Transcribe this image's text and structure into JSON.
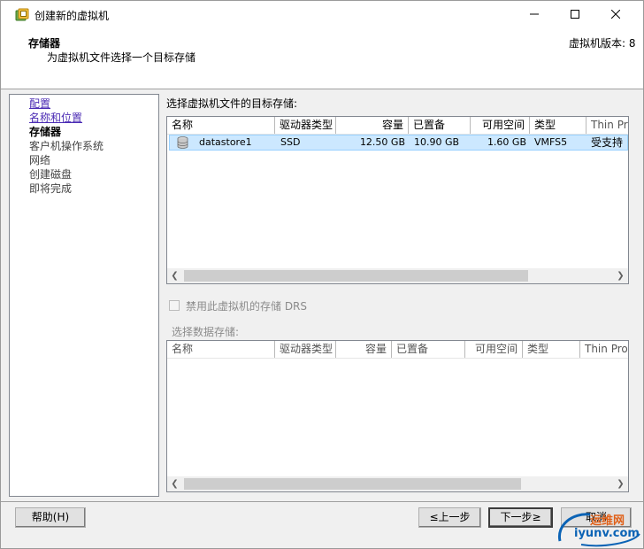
{
  "window": {
    "title": "创建新的虚拟机",
    "icon": "vm-wizard-icon"
  },
  "header": {
    "title": "存储器",
    "subtitle": "为虚拟机文件选择一个目标存储",
    "version_label": "虚拟机版本: 8"
  },
  "nav": {
    "items": [
      {
        "label": "配置",
        "state": "link"
      },
      {
        "label": "名称和位置",
        "state": "link"
      },
      {
        "label": "存储器",
        "state": "current"
      },
      {
        "label": "客户机操作系统",
        "state": "future"
      },
      {
        "label": "网络",
        "state": "future"
      },
      {
        "label": "创建磁盘",
        "state": "future"
      },
      {
        "label": "即将完成",
        "state": "future"
      }
    ]
  },
  "target_storage": {
    "label": "选择虚拟机文件的目标存储:",
    "columns": [
      "名称",
      "驱动器类型",
      "容量",
      "已置备",
      "可用空间",
      "类型",
      "Thin Provi"
    ],
    "rows": [
      {
        "name": "datastore1",
        "drive_type": "SSD",
        "capacity": "12.50 GB",
        "provisioned": "10.90 GB",
        "free": "1.60 GB",
        "type": "VMFS5",
        "thin": "受支持"
      }
    ]
  },
  "drs": {
    "checkbox_label": "禁用此虚拟机的存储 DRS",
    "checked": false
  },
  "datastore_select": {
    "label": "选择数据存储:",
    "columns": [
      "名称",
      "驱动器类型",
      "容量",
      "已置备",
      "可用空间",
      "类型",
      "Thin Provi"
    ]
  },
  "buttons": {
    "help": "帮助(H)",
    "back": "≤上一步",
    "next": "下一步≥",
    "cancel": "取消"
  },
  "watermark": {
    "top": "运维网",
    "bottom": "iyunv.com"
  }
}
